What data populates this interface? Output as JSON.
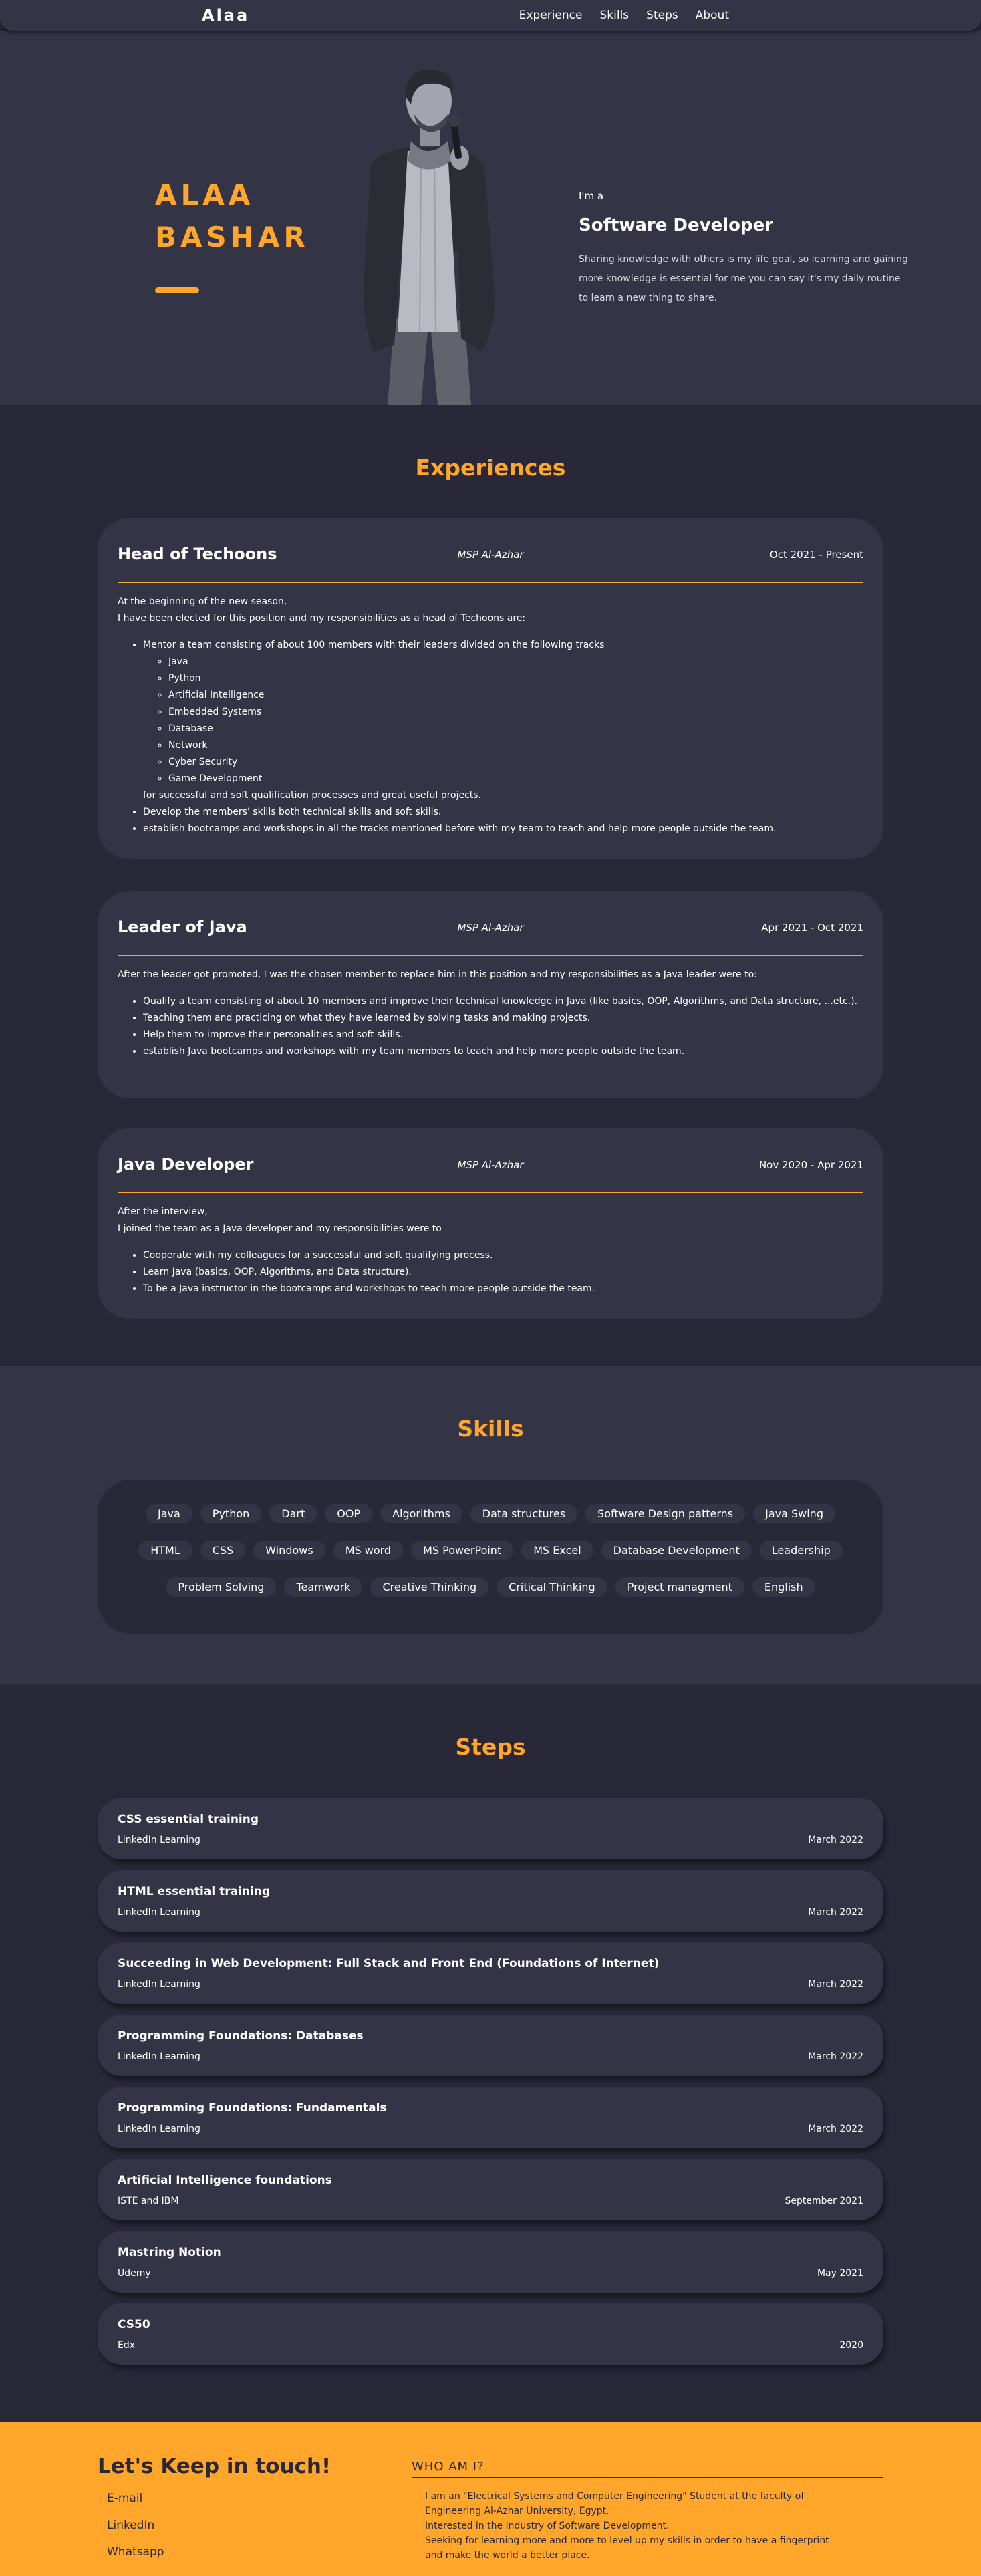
{
  "nav": {
    "logo": "Alaa",
    "links": [
      "Experience",
      "Skills",
      "Steps",
      "About"
    ]
  },
  "hero": {
    "name_line1": "ALAA",
    "name_line2": "BASHAR",
    "im": "I'm a",
    "role": "Software Developer",
    "text": "Sharing knowledge with others is my life goal, so learning and gaining more knowledge is essential for me you can say it's my daily routine to learn a new thing to share."
  },
  "sections": {
    "experiences": "Experiences",
    "skills": "Skills",
    "steps": "Steps"
  },
  "experiences": [
    {
      "role": "Head of Techoons",
      "org": "MSP Al-Azhar",
      "date": "Oct 2021 - Present",
      "intro1": "At the beginning of the new season,",
      "intro2": "I have been elected for this position and my responsibilities as a head of Techoons are:",
      "b1": "Mentor a team consisting of about 100 members with their leaders divided on the following tracks",
      "tracks": [
        "Java",
        "Python",
        "Artificial Intelligence",
        "Embedded Systems",
        "Database",
        "Network",
        "Cyber Security",
        "Game Development"
      ],
      "after_tracks": "for successful and soft qualification processes and great useful projects.",
      "b2": "Develop the members' skills both technical skills and soft skills.",
      "b3": "establish bootcamps and workshops in all the tracks mentioned before with my team to teach and help more people outside the team."
    },
    {
      "role": "Leader of Java",
      "org": "MSP Al-Azhar",
      "date": "Apr 2021 - Oct 2021",
      "intro1": "After the leader got promoted, I was the chosen member to replace him in this position and my responsibilities as a Java leader were to:",
      "b1": "Qualify a team consisting of about 10 members and improve their technical knowledge in Java (like basics, OOP, Algorithms, and Data structure, ...etc.).",
      "b2": "Teaching them and practicing on what they have learned by solving tasks and making projects.",
      "b3": "Help them to improve their personalities and soft skills.",
      "b4": "establish Java bootcamps and workshops with my team members to teach and help more people outside the team."
    },
    {
      "role": "Java Developer",
      "org": "MSP Al-Azhar",
      "date": "Nov 2020 - Apr 2021",
      "intro1": "After the interview,",
      "intro2": "I joined the team as a Java developer and my responsibilities were to",
      "b1": "Cooperate with my colleagues for a successful and soft qualifying process.",
      "b2": "Learn Java (basics, OOP, Algorithms, and Data structure).",
      "b3": "To be a Java instructor in the bootcamps and workshops to teach more people outside the team."
    }
  ],
  "skills": {
    "row1": [
      "Java",
      "Python",
      "Dart",
      "OOP",
      "Algorithms",
      "Data structures",
      "Software Design patterns",
      "Java Swing"
    ],
    "row2": [
      "HTML",
      "CSS",
      "Windows",
      "MS word",
      "MS PowerPoint",
      "MS Excel",
      "Database Development",
      "Leadership"
    ],
    "row3": [
      "Problem Solving",
      "Teamwork",
      "Creative Thinking",
      "Critical Thinking",
      "Project managment",
      "English"
    ]
  },
  "steps": [
    {
      "title": "CSS essential training",
      "source": "LinkedIn Learning",
      "date": "March 2022"
    },
    {
      "title": "HTML essential training",
      "source": "LinkedIn Learning",
      "date": "March 2022"
    },
    {
      "title": "Succeeding in Web Development: Full Stack and Front End (Foundations of Internet)",
      "source": "LinkedIn Learning",
      "date": "March 2022"
    },
    {
      "title": "Programming Foundations: Databases",
      "source": "LinkedIn Learning",
      "date": "March 2022"
    },
    {
      "title": "Programming Foundations: Fundamentals",
      "source": "LinkedIn Learning",
      "date": "March 2022"
    },
    {
      "title": "Artificial Intelligence foundations",
      "source": "ISTE and IBM",
      "date": "September 2021"
    },
    {
      "title": "Mastring Notion",
      "source": "Udemy",
      "date": "May 2021"
    },
    {
      "title": "CS50",
      "source": "Edx",
      "date": "2020"
    }
  ],
  "footer": {
    "title": "Let's Keep in touch!",
    "links": [
      "E-mail",
      "LinkedIn",
      "Whatsapp"
    ],
    "who_title": "WHO AM I?",
    "about1": "I am an \"Electrical Systems and Computer Engineering\" Student at the faculty of",
    "about2": "Engineering Al-Azhar University, Egypt.",
    "about3": "Interested in the Industry of Software Development.",
    "about4": "Seeking for learning more and more to level up my skills in order to have a fingerprint",
    "about5": "and make the world a better place."
  },
  "colors": {
    "accent": "#ffa62b",
    "background": "#292838",
    "surface": "#343447"
  }
}
